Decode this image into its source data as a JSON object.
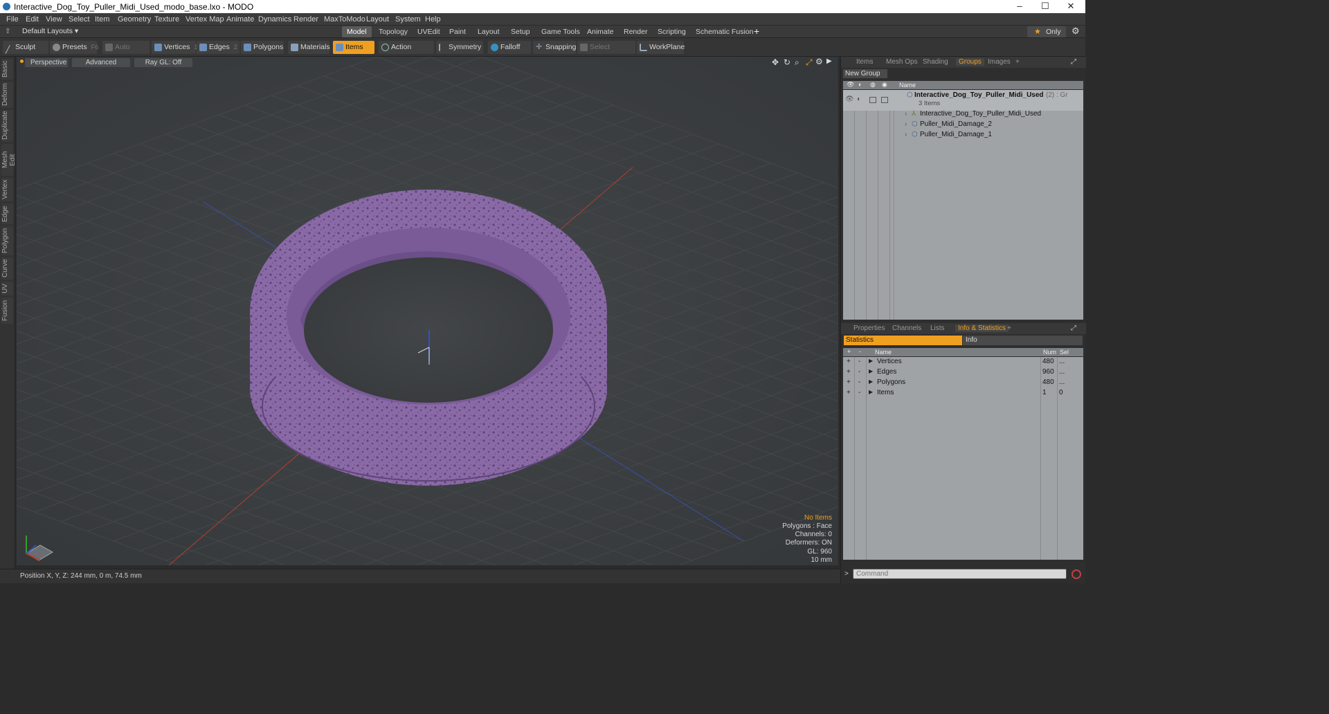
{
  "window": {
    "title": "Interactive_Dog_Toy_Puller_Midi_Used_modo_base.lxo - MODO",
    "minimize": "–",
    "maximize": "☐",
    "close": "✕"
  },
  "menu": [
    "File",
    "Edit",
    "View",
    "Select",
    "Item",
    "Geometry",
    "Texture",
    "Vertex Map",
    "Animate",
    "Dynamics",
    "Render",
    "MaxToModo",
    "Layout",
    "System",
    "Help"
  ],
  "layouts": {
    "selector": "Default Layouts ▾",
    "tabs": [
      "Model",
      "Topology",
      "UVEdit",
      "Paint",
      "Layout",
      "Setup",
      "Game Tools",
      "Animate",
      "Render",
      "Scripting",
      "Schematic Fusion"
    ],
    "active": "Model",
    "add": "+",
    "only": "Only"
  },
  "toolbar": {
    "sculpt": "Sculpt",
    "presets": "Presets",
    "presets_key": "F6",
    "auto_select": "Auto Select",
    "vertices": "Vertices",
    "vertices_key": "1",
    "edges": "Edges",
    "edges_key": "2",
    "polygons": "Polygons",
    "materials": "Materials",
    "items": "Items",
    "action_center": "Action Center",
    "symmetry": "Symmetry",
    "falloff": "Falloff",
    "snapping": "Snapping",
    "select_through": "Select Through",
    "workplane": "WorkPlane"
  },
  "left_tabs": [
    "Basic",
    "Deform",
    "Duplicate",
    "Mesh Edit",
    "Vertex",
    "Edge",
    "Polygon",
    "Curve",
    "UV",
    "Fusion"
  ],
  "viewport": {
    "perspective": "Perspective",
    "advanced": "Advanced",
    "raygl": "Ray GL: Off",
    "colors": {
      "object": "#8a6aa6",
      "object_dark": "#5e4478",
      "grid": "#4a4d50",
      "x_axis": "#b04030",
      "z_axis": "#3a4fb0"
    },
    "overlay": {
      "no_items": "No Items",
      "polygons": "Polygons : Face",
      "channels": "Channels: 0",
      "deformers": "Deformers: ON",
      "gl": "GL: 960",
      "unit": "10 mm"
    }
  },
  "status": {
    "position": "Position X, Y, Z:  244 mm, 0 m, 74.5 mm"
  },
  "top_panel": {
    "tabs": [
      "Items",
      "Mesh Ops",
      "Shading",
      "Groups",
      "Images"
    ],
    "active": "Groups",
    "add": "+",
    "new_group": "New Group",
    "name_header": "Name",
    "group": {
      "name": "Interactive_Dog_Toy_Puller_Midi_Used",
      "suffix": "(2) : Gr",
      "count": "3 Items"
    },
    "children": [
      "Interactive_Dog_Toy_Puller_Midi_Used",
      "Puller_Midi_Damage_2",
      "Puller_Midi_Damage_1"
    ]
  },
  "bottom_panel": {
    "tabs": [
      "Properties",
      "Channels",
      "Lists",
      "Info & Statistics"
    ],
    "active": "Info & Statistics",
    "add": "+",
    "statistics": "Statistics",
    "info": "Info",
    "headers": {
      "name": "Name",
      "num": "Num",
      "sel": "Sel"
    },
    "rows": [
      {
        "name": "Vertices",
        "num": "480",
        "sel": "..."
      },
      {
        "name": "Edges",
        "num": "960",
        "sel": "..."
      },
      {
        "name": "Polygons",
        "num": "480",
        "sel": "..."
      },
      {
        "name": "Items",
        "num": "1",
        "sel": "0"
      }
    ],
    "command_placeholder": "Command",
    "prompt": ">"
  },
  "accent": "#f0a020"
}
